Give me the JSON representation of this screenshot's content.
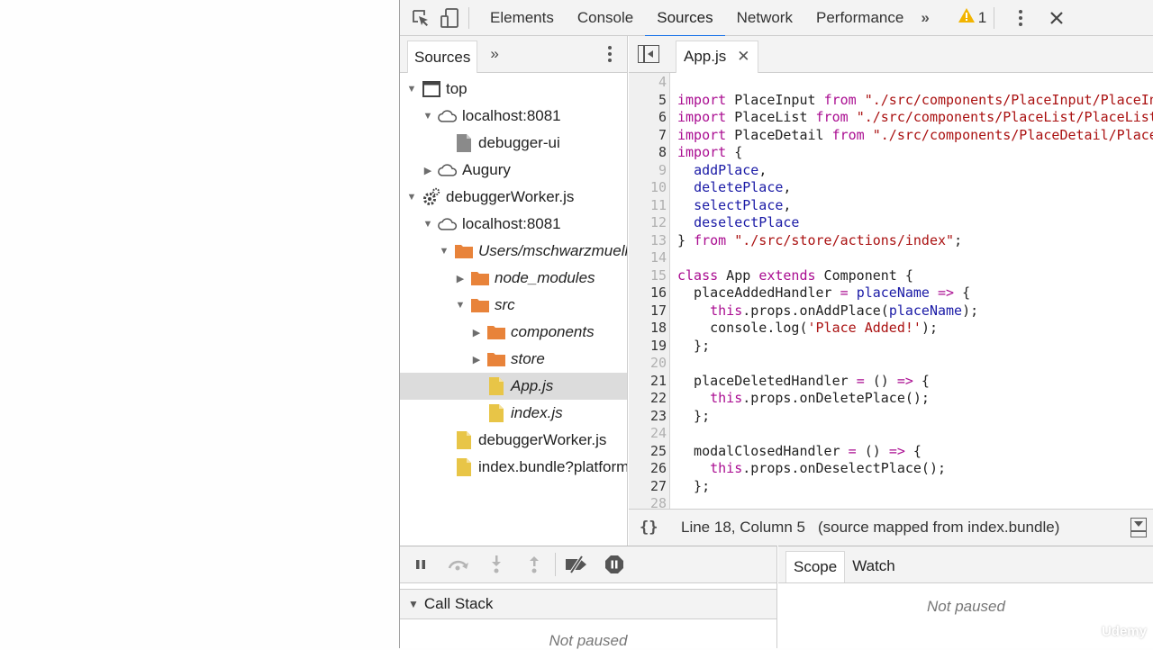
{
  "toolbar": {
    "tabs": [
      "Elements",
      "Console",
      "Sources",
      "Network",
      "Performance"
    ],
    "active_tab": "Sources",
    "more_tabs": "»",
    "warning_count": "1",
    "warning_color": "#f2b400",
    "accent_color": "#1a73e8"
  },
  "navigator": {
    "tab_label": "Sources",
    "more": "»",
    "tree": [
      {
        "label": "top",
        "icon": "frame",
        "expanded": true,
        "depth": 0,
        "italic": false
      },
      {
        "label": "localhost:8081",
        "icon": "cloud",
        "expanded": true,
        "depth": 1,
        "italic": false
      },
      {
        "label": "debugger-ui",
        "icon": "file-gray",
        "expanded": null,
        "depth": 2,
        "italic": false
      },
      {
        "label": "Augury",
        "icon": "cloud",
        "expanded": false,
        "depth": 1,
        "italic": false
      },
      {
        "label": "debuggerWorker.js",
        "icon": "gear",
        "expanded": true,
        "depth": 0,
        "italic": false
      },
      {
        "label": "localhost:8081",
        "icon": "cloud",
        "expanded": true,
        "depth": 1,
        "italic": false
      },
      {
        "label": "Users/mschwarzmueller",
        "icon": "folder",
        "expanded": true,
        "depth": 2,
        "italic": true
      },
      {
        "label": "node_modules",
        "icon": "folder",
        "expanded": false,
        "depth": 3,
        "italic": true
      },
      {
        "label": "src",
        "icon": "folder",
        "expanded": true,
        "depth": 3,
        "italic": true
      },
      {
        "label": "components",
        "icon": "folder",
        "expanded": false,
        "depth": 4,
        "italic": true
      },
      {
        "label": "store",
        "icon": "folder",
        "expanded": false,
        "depth": 4,
        "italic": true
      },
      {
        "label": "App.js",
        "icon": "file-yellow",
        "expanded": null,
        "depth": 4,
        "italic": true,
        "selected": true
      },
      {
        "label": "index.js",
        "icon": "file-yellow",
        "expanded": null,
        "depth": 4,
        "italic": true
      },
      {
        "label": "debuggerWorker.js",
        "icon": "file-yellow",
        "expanded": null,
        "depth": 2,
        "italic": false
      },
      {
        "label": "index.bundle?platform",
        "icon": "file-yellow",
        "expanded": null,
        "depth": 2,
        "italic": false
      }
    ]
  },
  "editor": {
    "open_file": "App.js",
    "lines": [
      {
        "n": 4,
        "dim": true,
        "tokens": []
      },
      {
        "n": 5,
        "dim": false,
        "tokens": [
          [
            "kw",
            "import"
          ],
          [
            "plain",
            " PlaceInput "
          ],
          [
            "kw",
            "from"
          ],
          [
            "plain",
            " "
          ],
          [
            "str",
            "\"./src/components/PlaceInput/PlaceInput\""
          ]
        ]
      },
      {
        "n": 6,
        "dim": false,
        "tokens": [
          [
            "kw",
            "import"
          ],
          [
            "plain",
            " PlaceList "
          ],
          [
            "kw",
            "from"
          ],
          [
            "plain",
            " "
          ],
          [
            "str",
            "\"./src/components/PlaceList/PlaceList\""
          ]
        ]
      },
      {
        "n": 7,
        "dim": false,
        "tokens": [
          [
            "kw",
            "import"
          ],
          [
            "plain",
            " PlaceDetail "
          ],
          [
            "kw",
            "from"
          ],
          [
            "plain",
            " "
          ],
          [
            "str",
            "\"./src/components/PlaceDetail/PlaceDetail\""
          ]
        ]
      },
      {
        "n": 8,
        "dim": false,
        "tokens": [
          [
            "kw",
            "import"
          ],
          [
            "plain",
            " {"
          ]
        ]
      },
      {
        "n": 9,
        "dim": true,
        "tokens": [
          [
            "plain",
            "  "
          ],
          [
            "ident",
            "addPlace"
          ],
          [
            "plain",
            ","
          ]
        ]
      },
      {
        "n": 10,
        "dim": true,
        "tokens": [
          [
            "plain",
            "  "
          ],
          [
            "ident",
            "deletePlace"
          ],
          [
            "plain",
            ","
          ]
        ]
      },
      {
        "n": 11,
        "dim": true,
        "tokens": [
          [
            "plain",
            "  "
          ],
          [
            "ident",
            "selectPlace"
          ],
          [
            "plain",
            ","
          ]
        ]
      },
      {
        "n": 12,
        "dim": true,
        "tokens": [
          [
            "plain",
            "  "
          ],
          [
            "ident",
            "deselectPlace"
          ]
        ]
      },
      {
        "n": 13,
        "dim": true,
        "tokens": [
          [
            "plain",
            "} "
          ],
          [
            "kw",
            "from"
          ],
          [
            "plain",
            " "
          ],
          [
            "str",
            "\"./src/store/actions/index\""
          ],
          [
            "plain",
            ";"
          ]
        ]
      },
      {
        "n": 14,
        "dim": true,
        "tokens": []
      },
      {
        "n": 15,
        "dim": true,
        "tokens": [
          [
            "kw",
            "class"
          ],
          [
            "plain",
            " App "
          ],
          [
            "kw",
            "extends"
          ],
          [
            "plain",
            " Component {"
          ]
        ]
      },
      {
        "n": 16,
        "dim": false,
        "tokens": [
          [
            "plain",
            "  placeAddedHandler "
          ],
          [
            "kw",
            "="
          ],
          [
            "plain",
            " "
          ],
          [
            "ident",
            "placeName"
          ],
          [
            "plain",
            " "
          ],
          [
            "kw",
            "=>"
          ],
          [
            "plain",
            " {"
          ]
        ]
      },
      {
        "n": 17,
        "dim": false,
        "tokens": [
          [
            "plain",
            "    "
          ],
          [
            "kw",
            "this"
          ],
          [
            "plain",
            ".props.onAddPlace("
          ],
          [
            "ident",
            "placeName"
          ],
          [
            "plain",
            ");"
          ]
        ]
      },
      {
        "n": 18,
        "dim": false,
        "tokens": [
          [
            "plain",
            "    console.log("
          ],
          [
            "str",
            "'Place Added!'"
          ],
          [
            "plain",
            ");"
          ]
        ]
      },
      {
        "n": 19,
        "dim": false,
        "tokens": [
          [
            "plain",
            "  };"
          ]
        ]
      },
      {
        "n": 20,
        "dim": true,
        "tokens": []
      },
      {
        "n": 21,
        "dim": false,
        "tokens": [
          [
            "plain",
            "  placeDeletedHandler "
          ],
          [
            "kw",
            "="
          ],
          [
            "plain",
            " () "
          ],
          [
            "kw",
            "=>"
          ],
          [
            "plain",
            " {"
          ]
        ]
      },
      {
        "n": 22,
        "dim": false,
        "tokens": [
          [
            "plain",
            "    "
          ],
          [
            "kw",
            "this"
          ],
          [
            "plain",
            ".props.onDeletePlace();"
          ]
        ]
      },
      {
        "n": 23,
        "dim": false,
        "tokens": [
          [
            "plain",
            "  };"
          ]
        ]
      },
      {
        "n": 24,
        "dim": true,
        "tokens": []
      },
      {
        "n": 25,
        "dim": false,
        "tokens": [
          [
            "plain",
            "  modalClosedHandler "
          ],
          [
            "kw",
            "="
          ],
          [
            "plain",
            " () "
          ],
          [
            "kw",
            "=>"
          ],
          [
            "plain",
            " {"
          ]
        ]
      },
      {
        "n": 26,
        "dim": false,
        "tokens": [
          [
            "plain",
            "    "
          ],
          [
            "kw",
            "this"
          ],
          [
            "plain",
            ".props.onDeselectPlace();"
          ]
        ]
      },
      {
        "n": 27,
        "dim": false,
        "tokens": [
          [
            "plain",
            "  };"
          ]
        ]
      },
      {
        "n": 28,
        "dim": true,
        "tokens": []
      }
    ],
    "status": {
      "braces": "{}",
      "position": "Line 18, Column 5",
      "mapped": "(source mapped from index.bundle)"
    }
  },
  "debugger": {
    "call_stack_label": "Call Stack",
    "call_stack_empty": "Not paused",
    "scope_tabs": [
      "Scope",
      "Watch"
    ],
    "active_scope_tab": "Scope",
    "scope_empty": "Not paused",
    "watermark": "Udemy"
  }
}
